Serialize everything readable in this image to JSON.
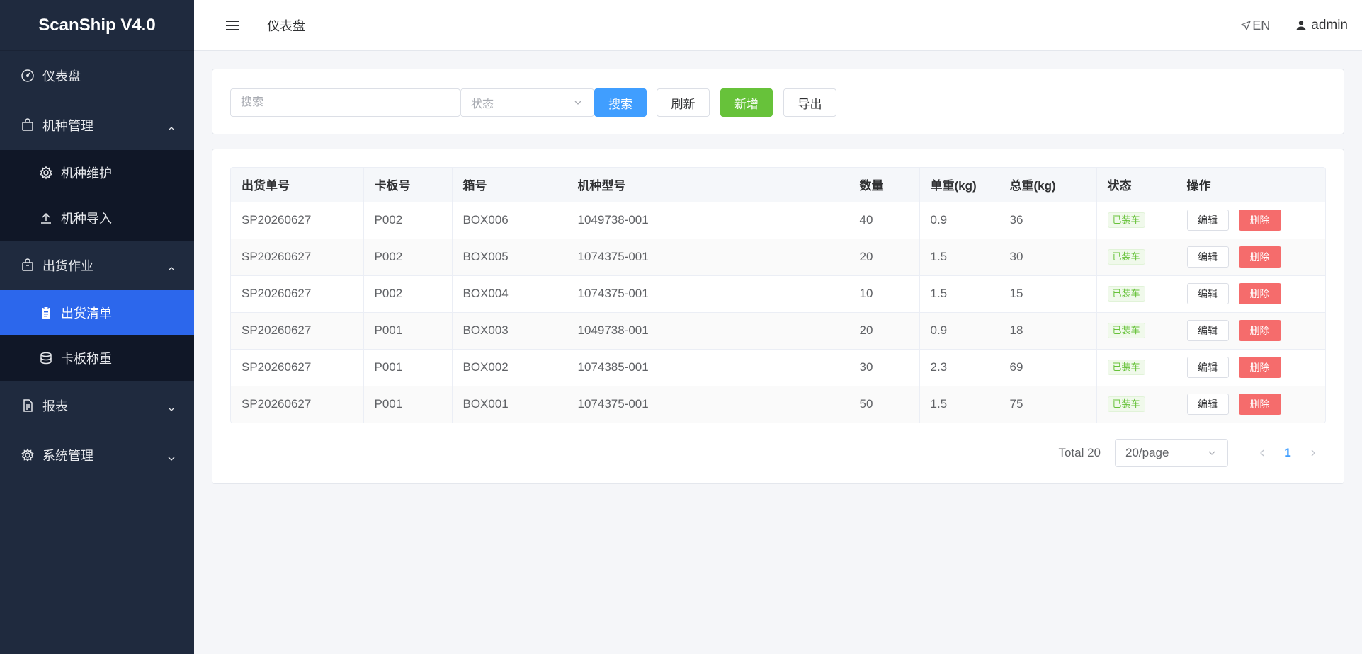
{
  "app": {
    "title": "ScanShip V4.0"
  },
  "sidebar": {
    "items": [
      {
        "label": "仪表盘",
        "icon": "dashboard-icon"
      },
      {
        "label": "机种管理",
        "icon": "bag-icon",
        "expanded": true,
        "children": [
          {
            "label": "机种维护",
            "icon": "gear-icon"
          },
          {
            "label": "机种导入",
            "icon": "upload-icon"
          }
        ]
      },
      {
        "label": "出货作业",
        "icon": "bag-icon",
        "expanded": true,
        "children": [
          {
            "label": "出货清单",
            "icon": "clipboard-icon",
            "active": true
          },
          {
            "label": "卡板称重",
            "icon": "database-icon"
          }
        ]
      },
      {
        "label": "报表",
        "icon": "document-icon",
        "expanded": false
      },
      {
        "label": "系统管理",
        "icon": "gear-icon",
        "expanded": false
      }
    ]
  },
  "header": {
    "breadcrumb": "仪表盘",
    "lang": "EN",
    "user": "admin"
  },
  "search": {
    "placeholder": "搜索",
    "status_placeholder": "状态",
    "search_label": "搜索",
    "refresh_label": "刷新",
    "add_label": "新增",
    "export_label": "导出"
  },
  "table": {
    "columns": [
      "出货单号",
      "卡板号",
      "箱号",
      "机种型号",
      "数量",
      "单重(kg)",
      "总重(kg)",
      "状态",
      "操作"
    ],
    "rows": [
      {
        "order": "SP20260627",
        "pallet": "P002",
        "box": "BOX006",
        "model": "1049738-001",
        "qty": "40",
        "unit_weight": "0.9",
        "total_weight": "36",
        "status": "已装车"
      },
      {
        "order": "SP20260627",
        "pallet": "P002",
        "box": "BOX005",
        "model": "1074375-001",
        "qty": "20",
        "unit_weight": "1.5",
        "total_weight": "30",
        "status": "已装车"
      },
      {
        "order": "SP20260627",
        "pallet": "P002",
        "box": "BOX004",
        "model": "1074375-001",
        "qty": "10",
        "unit_weight": "1.5",
        "total_weight": "15",
        "status": "已装车"
      },
      {
        "order": "SP20260627",
        "pallet": "P001",
        "box": "BOX003",
        "model": "1049738-001",
        "qty": "20",
        "unit_weight": "0.9",
        "total_weight": "18",
        "status": "已装车"
      },
      {
        "order": "SP20260627",
        "pallet": "P001",
        "box": "BOX002",
        "model": "1074385-001",
        "qty": "30",
        "unit_weight": "2.3",
        "total_weight": "69",
        "status": "已装车"
      },
      {
        "order": "SP20260627",
        "pallet": "P001",
        "box": "BOX001",
        "model": "1074375-001",
        "qty": "50",
        "unit_weight": "1.5",
        "total_weight": "75",
        "status": "已装车"
      }
    ],
    "edit_label": "编辑",
    "delete_label": "删除"
  },
  "pagination": {
    "total": "Total 20",
    "page_size": "20/page",
    "current_page": "1"
  },
  "colors": {
    "sidebar_bg": "#1f2a3e",
    "submenu_bg": "#101727",
    "active": "#2c67ec",
    "primary": "#409eff",
    "success": "#67c23a",
    "danger": "#f56c6c"
  }
}
